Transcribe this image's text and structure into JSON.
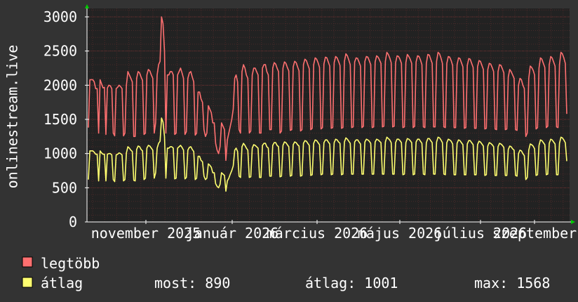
{
  "chart_data": {
    "type": "line",
    "ylabel": "onlinestream.live",
    "ylim": [
      0,
      3000
    ],
    "yticks": [
      0,
      500,
      1000,
      1500,
      2000,
      2500,
      3000
    ],
    "x_tick_labels": [
      "november 2025",
      "január 2026",
      "március 2026",
      "május 2026",
      "július 2026",
      "szeptember"
    ],
    "grid": true,
    "colors": {
      "background": "#333333",
      "plot": "#222222",
      "grid_minor": "#4a2a2a",
      "grid_major": "#6a3030",
      "axis": "#ffffff",
      "arrow": "#00cc00"
    },
    "series": [
      {
        "name": "legtöbb",
        "color": "#ff7070",
        "values": [
          1380,
          2080,
          2080,
          2080,
          2050,
          1950,
          1950,
          1300,
          2080,
          2020,
          1960,
          1970,
          1280,
          1960,
          2000,
          1990,
          1950,
          1300,
          1260,
          1950,
          1970,
          2000,
          1980,
          1950,
          1260,
          1300,
          2000,
          2200,
          2150,
          2100,
          2050,
          1250,
          1250,
          2100,
          2200,
          2180,
          2120,
          2070,
          1280,
          1300,
          2150,
          2230,
          2210,
          2150,
          2100,
          1300,
          1450,
          2150,
          2300,
          2350,
          3000,
          2900,
          2500,
          1300,
          2150,
          2150,
          2200,
          2200,
          2150,
          1280,
          1300,
          2150,
          2200,
          2250,
          2180,
          2100,
          1280,
          1320,
          2100,
          2180,
          2200,
          2120,
          2050,
          1270,
          1300,
          1900,
          1900,
          1800,
          1750,
          1350,
          1250,
          1300,
          1700,
          1650,
          1600,
          1450,
          1450,
          1150,
          1050,
          1000,
          1100,
          1450,
          1400,
          1350,
          900,
          1200,
          1300,
          1400,
          1500,
          1650,
          2100,
          2150,
          2050,
          1350,
          1300,
          2200,
          2300,
          2250,
          2150,
          2100,
          1300,
          1330,
          2150,
          2250,
          2250,
          2200,
          2150,
          1300,
          1300,
          2250,
          2300,
          2300,
          2200,
          2150,
          1350,
          1350,
          2250,
          2330,
          2310,
          2250,
          2200,
          1300,
          1330,
          2250,
          2340,
          2320,
          2260,
          2210,
          1340,
          1350,
          2270,
          2350,
          2330,
          2270,
          2210,
          1330,
          1350,
          2300,
          2380,
          2360,
          2300,
          2240,
          1350,
          1370,
          2300,
          2400,
          2380,
          2330,
          2260,
          1360,
          1380,
          2310,
          2410,
          2400,
          2340,
          2280,
          1370,
          1380,
          2330,
          2420,
          2400,
          2350,
          2290,
          1370,
          1380,
          2350,
          2460,
          2430,
          2370,
          2300,
          1380,
          1390,
          2340,
          2400,
          2390,
          2340,
          2280,
          1380,
          1400,
          2350,
          2420,
          2410,
          2360,
          2300,
          1380,
          1390,
          2340,
          2430,
          2410,
          2370,
          2320,
          1390,
          1400,
          2350,
          2480,
          2450,
          2400,
          2330,
          1390,
          1400,
          2330,
          2430,
          2420,
          2380,
          2320,
          1380,
          1390,
          2330,
          2450,
          2420,
          2380,
          2320,
          1380,
          1400,
          2340,
          2430,
          2420,
          2370,
          2300,
          1390,
          1380,
          2320,
          2450,
          2440,
          2380,
          2320,
          1390,
          1390,
          2350,
          2480,
          2460,
          2400,
          2320,
          1390,
          1380,
          2320,
          2420,
          2410,
          2360,
          2290,
          1380,
          1380,
          2300,
          2400,
          2390,
          2330,
          2270,
          1370,
          1380,
          2290,
          2390,
          2380,
          2320,
          2260,
          1370,
          1370,
          2270,
          2360,
          2350,
          2290,
          2230,
          1360,
          1370,
          2230,
          2320,
          2310,
          2260,
          2200,
          1360,
          1350,
          2200,
          2300,
          2290,
          2240,
          2180,
          1350,
          1360,
          2120,
          2230,
          2200,
          2150,
          2100,
          1350,
          1340,
          2000,
          2100,
          2080,
          2000,
          1950,
          1250,
          1300,
          2100,
          2280,
          2260,
          2220,
          2150,
          1360,
          1380,
          2250,
          2400,
          2380,
          2320,
          2260,
          1380,
          1400,
          2300,
          2420,
          2400,
          2340,
          2280,
          1390,
          1380,
          2300,
          2480,
          2460,
          2400,
          2320,
          1580
        ]
      },
      {
        "name": "átlag",
        "color": "#ffff70",
        "values": [
          620,
          1040,
          1040,
          1040,
          1020,
          990,
          990,
          600,
          1040,
          1010,
          990,
          990,
          600,
          990,
          1000,
          1000,
          980,
          620,
          590,
          980,
          990,
          1010,
          1000,
          980,
          600,
          620,
          1010,
          1100,
          1080,
          1050,
          1030,
          610,
          600,
          1060,
          1110,
          1100,
          1060,
          1040,
          620,
          640,
          1080,
          1120,
          1110,
          1080,
          1050,
          640,
          720,
          1080,
          1150,
          1180,
          1520,
          1460,
          1250,
          640,
          1080,
          1080,
          1100,
          1100,
          1080,
          630,
          640,
          1080,
          1100,
          1120,
          1090,
          1050,
          630,
          650,
          1050,
          1090,
          1100,
          1060,
          1030,
          620,
          640,
          960,
          960,
          900,
          880,
          670,
          620,
          640,
          850,
          830,
          800,
          720,
          720,
          560,
          520,
          500,
          550,
          720,
          700,
          680,
          450,
          600,
          640,
          700,
          750,
          820,
          1050,
          1080,
          1030,
          670,
          650,
          1100,
          1150,
          1120,
          1080,
          1050,
          650,
          660,
          1080,
          1130,
          1120,
          1100,
          1080,
          650,
          650,
          1120,
          1150,
          1150,
          1100,
          1080,
          670,
          670,
          1120,
          1160,
          1160,
          1120,
          1100,
          660,
          670,
          1120,
          1170,
          1160,
          1130,
          1100,
          670,
          680,
          1130,
          1170,
          1160,
          1130,
          1110,
          670,
          680,
          1150,
          1190,
          1180,
          1150,
          1120,
          680,
          690,
          1150,
          1200,
          1190,
          1160,
          1130,
          690,
          700,
          1160,
          1200,
          1200,
          1170,
          1140,
          690,
          700,
          1160,
          1210,
          1200,
          1170,
          1150,
          690,
          700,
          1170,
          1230,
          1210,
          1180,
          1150,
          700,
          700,
          1170,
          1200,
          1200,
          1170,
          1140,
          700,
          700,
          1170,
          1210,
          1200,
          1180,
          1150,
          700,
          700,
          1170,
          1210,
          1200,
          1180,
          1160,
          700,
          700,
          1170,
          1240,
          1220,
          1200,
          1160,
          700,
          700,
          1160,
          1210,
          1210,
          1190,
          1160,
          690,
          700,
          1160,
          1220,
          1210,
          1190,
          1160,
          690,
          700,
          1170,
          1210,
          1210,
          1180,
          1150,
          700,
          690,
          1160,
          1220,
          1220,
          1190,
          1160,
          700,
          700,
          1170,
          1240,
          1230,
          1200,
          1160,
          700,
          690,
          1160,
          1210,
          1200,
          1180,
          1140,
          690,
          690,
          1150,
          1200,
          1190,
          1160,
          1130,
          690,
          690,
          1140,
          1190,
          1190,
          1160,
          1130,
          690,
          690,
          1130,
          1180,
          1170,
          1140,
          1110,
          680,
          690,
          1110,
          1160,
          1150,
          1130,
          1100,
          680,
          680,
          1100,
          1150,
          1140,
          1120,
          1090,
          680,
          680,
          1060,
          1110,
          1100,
          1070,
          1050,
          680,
          670,
          1000,
          1050,
          1040,
          1000,
          970,
          620,
          650,
          1050,
          1140,
          1130,
          1110,
          1070,
          680,
          690,
          1120,
          1200,
          1190,
          1160,
          1130,
          690,
          700,
          1150,
          1210,
          1200,
          1170,
          1140,
          690,
          690,
          1150,
          1240,
          1230,
          1200,
          1160,
          890
        ]
      }
    ],
    "legend": [
      {
        "label": "legtöbb",
        "color": "#ff7070"
      },
      {
        "label": "átlag",
        "color": "#ffff70"
      }
    ],
    "stats": {
      "most": "most: 890",
      "atlag": "átlag: 1001",
      "max": "max: 1568"
    }
  }
}
